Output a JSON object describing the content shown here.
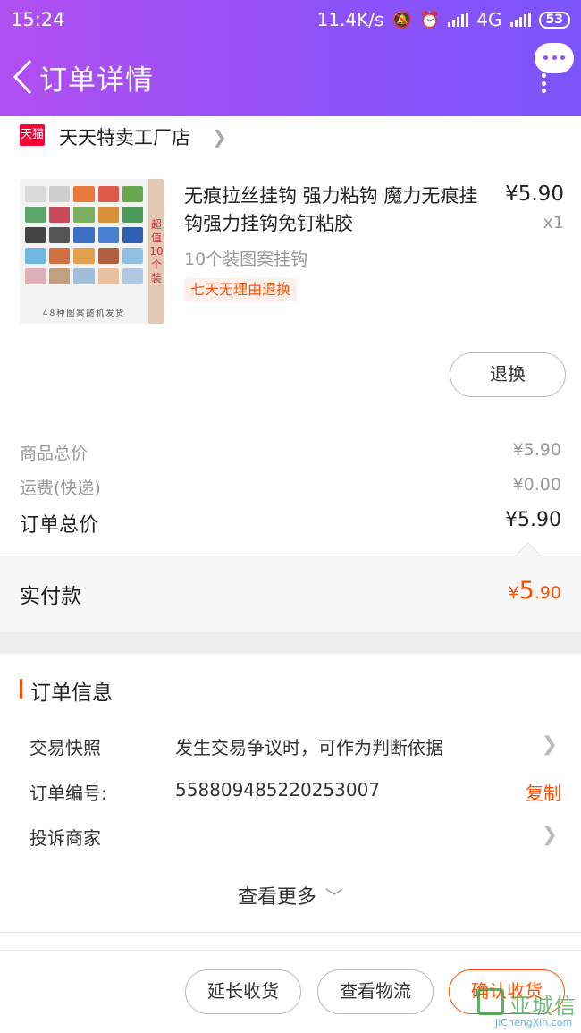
{
  "status_bar": {
    "time": "15:24",
    "network_speed": "11.4K/s",
    "network_type": "4G",
    "battery": "53",
    "icons": [
      "mute-icon",
      "alarm-icon",
      "signal-icon",
      "signal-icon"
    ]
  },
  "header": {
    "title": "订单详情",
    "back_icon": "chevron-left-icon",
    "more_icon": "more-dots-icon"
  },
  "shop": {
    "badge": "天猫",
    "name": "天天特卖工厂店"
  },
  "product": {
    "title": "无痕拉丝挂钩 强力粘钩 魔力无痕挂钩强力挂钩免钉粘胶",
    "price": "¥5.90",
    "quantity": "x1",
    "spec": "10个装图案挂钩",
    "tag": "七天无理由退换",
    "thumb_side_text": "超值10个装",
    "thumb_caption": "48种图案随机发货"
  },
  "refund_button": "退换",
  "summary": {
    "goods_label": "商品总价",
    "goods_value": "¥5.90",
    "shipping_label": "运费(快递)",
    "shipping_value": "¥0.00",
    "total_label": "订单总价",
    "total_value": "¥5.90",
    "paid_label": "实付款",
    "paid_currency": "¥",
    "paid_int": "5",
    "paid_dec": ".90"
  },
  "order_info": {
    "heading": "订单信息",
    "rows": [
      {
        "label": "交易快照",
        "value": "发生交易争议时，可作为判断依据"
      },
      {
        "label": "订单编号:",
        "value": "558809485220253007",
        "action": "复制"
      },
      {
        "label": "投诉商家",
        "value": ""
      }
    ],
    "view_more": "查看更多"
  },
  "actions": {
    "extend": "延长收货",
    "logistics": "查看物流",
    "confirm": "确认收货"
  },
  "watermark": {
    "text": "亚城信",
    "sub": "JiChengXin.com"
  },
  "colors": {
    "header_start": "#b14ff0",
    "header_end": "#7d55fb",
    "accent": "#ff5000",
    "tmall_red": "#ff0036"
  }
}
